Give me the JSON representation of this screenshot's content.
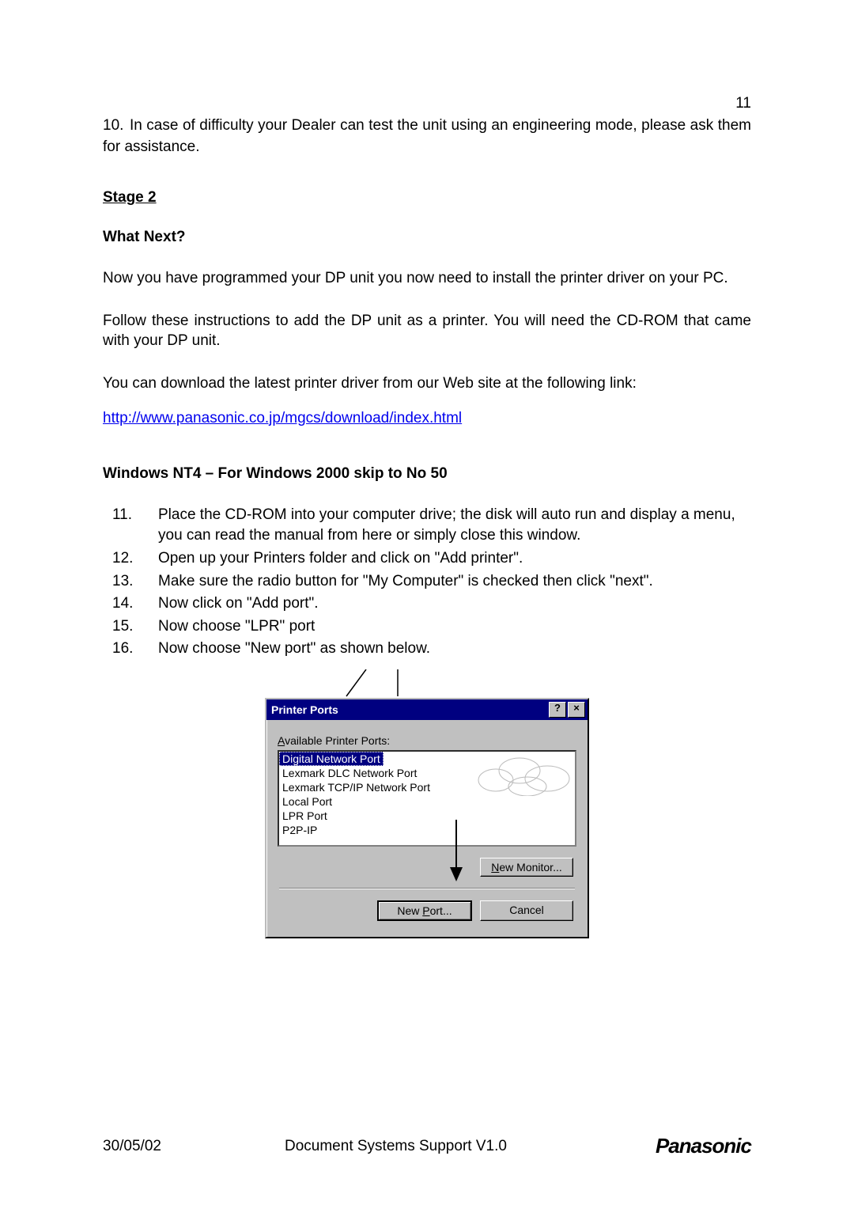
{
  "page_number": "11",
  "intro": {
    "num": "10.",
    "text": "In case of difficulty your Dealer can test the unit using an engineering mode, please ask them for assistance."
  },
  "stage_heading": "Stage 2",
  "what_next": "What Next?",
  "para1": "Now you have programmed your DP unit you now need to install the printer driver on your PC.",
  "para2": "Follow these instructions to add the DP unit as a printer. You will need the CD-ROM that came with your DP unit.",
  "para3": "You can download the latest printer driver from our Web site at the following link:",
  "link": "http://www.panasonic.co.jp/mgcs/download/index.html",
  "sub_heading": "Windows NT4 – For Windows 2000 skip to No 50",
  "steps": [
    {
      "n": "11.",
      "t": "Place the CD-ROM into your computer drive; the disk will auto run and display a menu, you can read the manual from here or simply close this window."
    },
    {
      "n": "12.",
      "t": "Open up your Printers folder and click on \"Add printer\"."
    },
    {
      "n": "13.",
      "t": "Make sure the radio button for \"My Computer\" is checked then click \"next\"."
    },
    {
      "n": "14.",
      "t": "Now click on \"Add port\"."
    },
    {
      "n": "15.",
      "t": "Now choose \"LPR\" port"
    },
    {
      "n": "16.",
      "t": "Now choose \"New port\" as shown below."
    }
  ],
  "dialog": {
    "title": "Printer Ports",
    "help_btn": "?",
    "close_btn": "×",
    "available_label_pre": "A",
    "available_label_rest": "vailable Printer Ports:",
    "items": [
      "Digital Network Port",
      "Lexmark DLC Network Port",
      "Lexmark TCP/IP Network Port",
      "Local Port",
      "LPR Port",
      "P2P-IP"
    ],
    "selected_index": 0,
    "new_monitor_pre": "N",
    "new_monitor_rest": "ew Monitor...",
    "new_port_pre": "New ",
    "new_port_mid": "P",
    "new_port_rest": "ort...",
    "cancel": "Cancel"
  },
  "footer": {
    "date": "30/05/02",
    "center": "Document Systems Support V1.0",
    "brand": "Panasonic"
  }
}
